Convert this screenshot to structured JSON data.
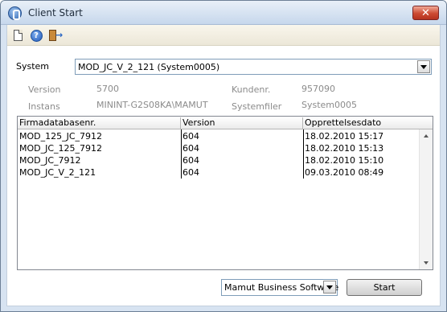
{
  "window": {
    "title": "Client Start",
    "close_glyph": "✕"
  },
  "toolbar": {
    "icons": [
      "new-document-icon",
      "help-icon",
      "exit-icon"
    ],
    "help_glyph": "?",
    "exit_glyph": "→"
  },
  "system": {
    "label": "System",
    "value": "MOD_JC_V_2_121 (System0005)"
  },
  "info": {
    "version_label": "Version",
    "version_value": "5700",
    "kundenr_label": "Kundenr.",
    "kundenr_value": "957090",
    "instans_label": "Instans",
    "instans_value": "MININT-G2S08KA\\MAMUT",
    "systemfiler_label": "Systemfiler",
    "systemfiler_value": "System0005"
  },
  "grid": {
    "columns": [
      "Firmadatabasenr.",
      "Version",
      "Opprettelsesdato"
    ],
    "rows": [
      [
        "MOD_125_JC_7912",
        "604",
        "18.02.2010 15:17"
      ],
      [
        "MOD_JC_125_7912",
        "604",
        "18.02.2010 15:13"
      ],
      [
        "MOD_JC_7912",
        "604",
        "18.02.2010 15:10"
      ],
      [
        "MOD_JC_V_2_121",
        "604",
        "09.03.2010 08:49"
      ]
    ]
  },
  "footer": {
    "product_value": "Mamut Business Software",
    "start_label": "Start"
  },
  "colors": {
    "titlebar": "#c6d7ec",
    "close_button": "#cc4a32",
    "muted_text": "#8b8b8b"
  }
}
